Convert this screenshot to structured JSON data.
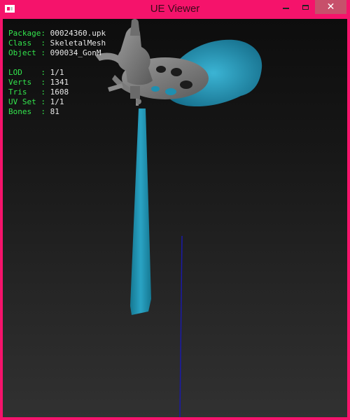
{
  "window": {
    "title": "UE Viewer",
    "close_glyph": "✕",
    "icons": {
      "app": "app-window-icon",
      "minimize": "minimize-icon",
      "maximize": "maximize-icon",
      "close": "close-icon"
    },
    "colors": {
      "frame": "#f5136b",
      "close_button": "#c7506b"
    }
  },
  "info": {
    "package_label": "Package:",
    "package_value": "00024360.upk",
    "class_label": "Class  :",
    "class_value": "SkeletalMesh",
    "object_label": "Object :",
    "object_value": "090034_GonM",
    "lod_label": "LOD    :",
    "lod_value": "1/1",
    "verts_label": "Verts  :",
    "verts_value": "1341",
    "tris_label": "Tris   :",
    "tris_value": "1608",
    "uvset_label": "UV Set :",
    "uvset_value": "1/1",
    "bones_label": "Bones  :",
    "bones_value": "81",
    "colors": {
      "label": "#33e64d",
      "value": "#e8e8e8"
    }
  },
  "scene": {
    "mesh_colors": {
      "stone": "#7d7d7d",
      "cloth": "#1f8fb0",
      "axis": "#1a1aa8"
    }
  }
}
